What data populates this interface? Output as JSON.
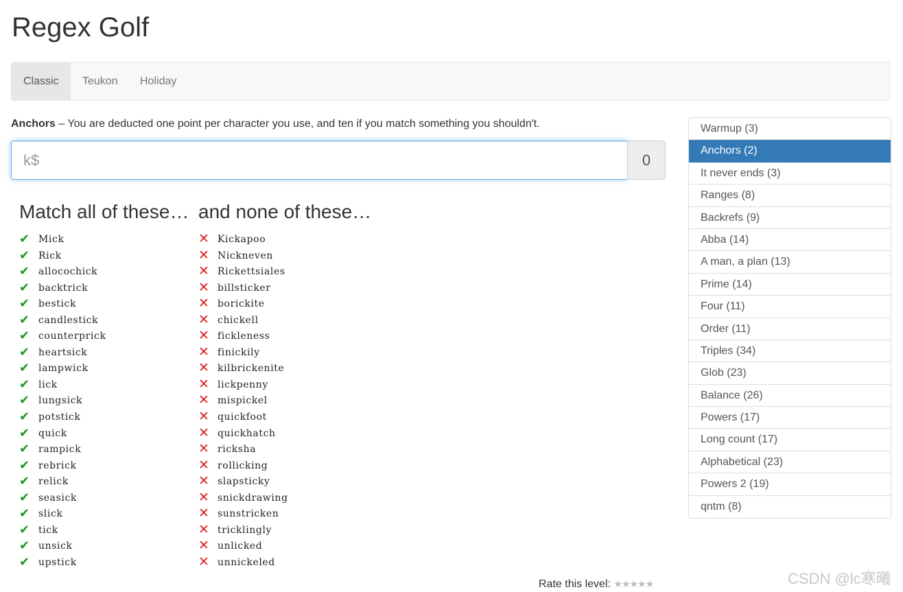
{
  "title": "Regex Golf",
  "nav": {
    "tabs": [
      {
        "label": "Classic",
        "active": true
      },
      {
        "label": "Teukon",
        "active": false
      },
      {
        "label": "Holiday",
        "active": false
      }
    ]
  },
  "level": {
    "name": "Anchors",
    "description": " – You are deducted one point per character you use, and ten if you match something you shouldn't."
  },
  "regex_input": {
    "placeholder": "k$",
    "value": ""
  },
  "score": "0",
  "match_column": {
    "heading": "Match all of these…",
    "words": [
      "Mick",
      "Rick",
      "allocochick",
      "backtrick",
      "bestick",
      "candlestick",
      "counterprick",
      "heartsick",
      "lampwick",
      "lick",
      "lungsick",
      "potstick",
      "quick",
      "rampick",
      "rebrick",
      "relick",
      "seasick",
      "slick",
      "tick",
      "unsick",
      "upstick"
    ]
  },
  "exclude_column": {
    "heading": "and none of these…",
    "words": [
      "Kickapoo",
      "Nickneven",
      "Rickettsiales",
      "billsticker",
      "borickite",
      "chickell",
      "fickleness",
      "finickily",
      "kilbrickenite",
      "lickpenny",
      "mispickel",
      "quickfoot",
      "quickhatch",
      "ricksha",
      "rollicking",
      "slapsticky",
      "snickdrawing",
      "sunstricken",
      "tricklingly",
      "unlicked",
      "unnickeled"
    ]
  },
  "levels": [
    {
      "label": "Warmup (3)",
      "active": false
    },
    {
      "label": "Anchors (2)",
      "active": true
    },
    {
      "label": "It never ends (3)",
      "active": false
    },
    {
      "label": "Ranges (8)",
      "active": false
    },
    {
      "label": "Backrefs (9)",
      "active": false
    },
    {
      "label": "Abba (14)",
      "active": false
    },
    {
      "label": "A man, a plan (13)",
      "active": false
    },
    {
      "label": "Prime (14)",
      "active": false
    },
    {
      "label": "Four (11)",
      "active": false
    },
    {
      "label": "Order (11)",
      "active": false
    },
    {
      "label": "Triples (34)",
      "active": false
    },
    {
      "label": "Glob (23)",
      "active": false
    },
    {
      "label": "Balance (26)",
      "active": false
    },
    {
      "label": "Powers (17)",
      "active": false
    },
    {
      "label": "Long count (17)",
      "active": false
    },
    {
      "label": "Alphabetical (23)",
      "active": false
    },
    {
      "label": "Powers 2 (19)",
      "active": false
    },
    {
      "label": "qntm (8)",
      "active": false
    }
  ],
  "rating": {
    "label": "Rate this level: ",
    "stars": "★★★★★"
  },
  "icons": {
    "match": "check-icon",
    "exclude": "cross-icon"
  },
  "colors": {
    "accent": "#337ab7",
    "match": "#1a9a1a",
    "exclude": "#e02020"
  },
  "watermark": "CSDN @lc寒曦"
}
